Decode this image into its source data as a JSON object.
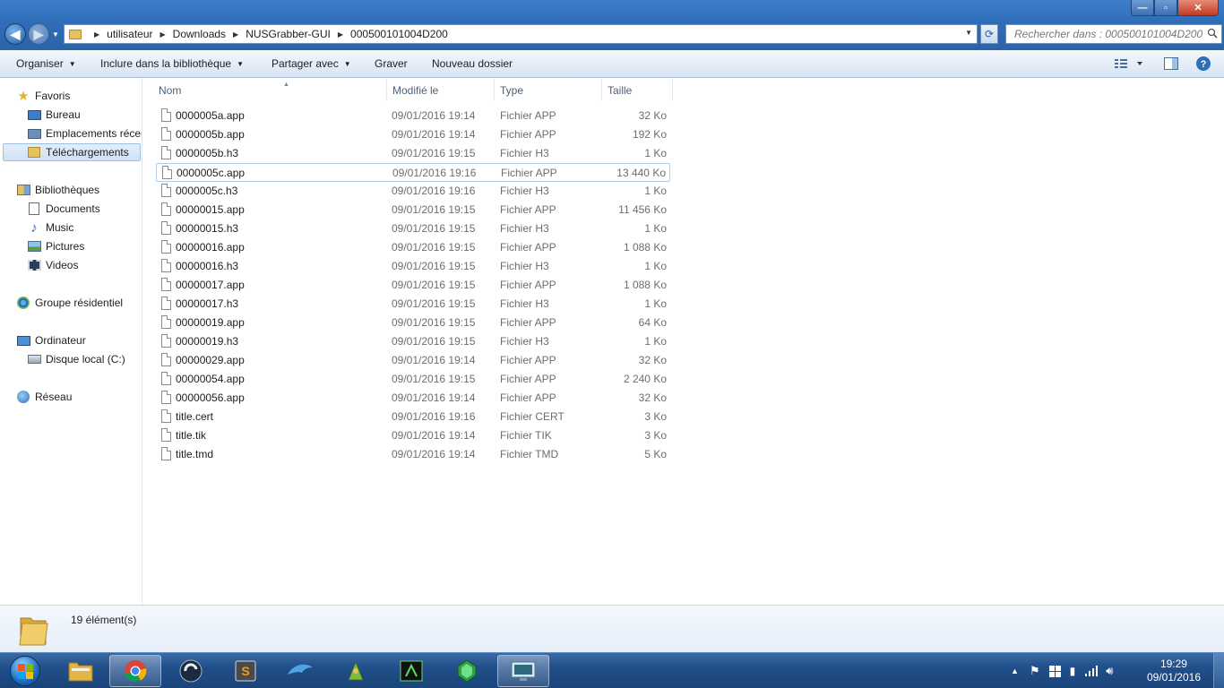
{
  "window": {
    "buttons": {
      "minimize": "—",
      "maximize": "▫",
      "close": "✕"
    }
  },
  "address": {
    "crumbs": [
      "utilisateur",
      "Downloads",
      "NUSGrabber-GUI",
      "000500101004D200"
    ],
    "search_placeholder": "Rechercher dans : 000500101004D200"
  },
  "toolbar": {
    "organize": "Organiser",
    "include": "Inclure dans la bibliothèque",
    "share": "Partager avec",
    "burn": "Graver",
    "new_folder": "Nouveau dossier"
  },
  "sidebar": {
    "favorites": "Favoris",
    "desktop": "Bureau",
    "recent": "Emplacements récents",
    "downloads": "Téléchargements",
    "libraries": "Bibliothèques",
    "documents": "Documents",
    "music": "Music",
    "pictures": "Pictures",
    "videos": "Videos",
    "homegroup": "Groupe résidentiel",
    "computer": "Ordinateur",
    "local_disk": "Disque local (C:)",
    "network": "Réseau"
  },
  "columns": {
    "name": "Nom",
    "modified": "Modifié le",
    "type": "Type",
    "size": "Taille"
  },
  "files": [
    {
      "name": "0000005a.app",
      "date": "09/01/2016 19:14",
      "type": "Fichier APP",
      "size": "32 Ko"
    },
    {
      "name": "0000005b.app",
      "date": "09/01/2016 19:14",
      "type": "Fichier APP",
      "size": "192 Ko"
    },
    {
      "name": "0000005b.h3",
      "date": "09/01/2016 19:15",
      "type": "Fichier H3",
      "size": "1 Ko"
    },
    {
      "name": "0000005c.app",
      "date": "09/01/2016 19:16",
      "type": "Fichier APP",
      "size": "13 440 Ko"
    },
    {
      "name": "0000005c.h3",
      "date": "09/01/2016 19:16",
      "type": "Fichier H3",
      "size": "1 Ko"
    },
    {
      "name": "00000015.app",
      "date": "09/01/2016 19:15",
      "type": "Fichier APP",
      "size": "11 456 Ko"
    },
    {
      "name": "00000015.h3",
      "date": "09/01/2016 19:15",
      "type": "Fichier H3",
      "size": "1 Ko"
    },
    {
      "name": "00000016.app",
      "date": "09/01/2016 19:15",
      "type": "Fichier APP",
      "size": "1 088 Ko"
    },
    {
      "name": "00000016.h3",
      "date": "09/01/2016 19:15",
      "type": "Fichier H3",
      "size": "1 Ko"
    },
    {
      "name": "00000017.app",
      "date": "09/01/2016 19:15",
      "type": "Fichier APP",
      "size": "1 088 Ko"
    },
    {
      "name": "00000017.h3",
      "date": "09/01/2016 19:15",
      "type": "Fichier H3",
      "size": "1 Ko"
    },
    {
      "name": "00000019.app",
      "date": "09/01/2016 19:15",
      "type": "Fichier APP",
      "size": "64 Ko"
    },
    {
      "name": "00000019.h3",
      "date": "09/01/2016 19:15",
      "type": "Fichier H3",
      "size": "1 Ko"
    },
    {
      "name": "00000029.app",
      "date": "09/01/2016 19:14",
      "type": "Fichier APP",
      "size": "32 Ko"
    },
    {
      "name": "00000054.app",
      "date": "09/01/2016 19:15",
      "type": "Fichier APP",
      "size": "2 240 Ko"
    },
    {
      "name": "00000056.app",
      "date": "09/01/2016 19:14",
      "type": "Fichier APP",
      "size": "32 Ko"
    },
    {
      "name": "title.cert",
      "date": "09/01/2016 19:16",
      "type": "Fichier CERT",
      "size": "3 Ko"
    },
    {
      "name": "title.tik",
      "date": "09/01/2016 19:14",
      "type": "Fichier TIK",
      "size": "3 Ko"
    },
    {
      "name": "title.tmd",
      "date": "09/01/2016 19:14",
      "type": "Fichier TMD",
      "size": "5 Ko"
    }
  ],
  "hovered_file": "0000005c.app",
  "status": {
    "count": "19 élément(s)"
  },
  "taskbar": {
    "apps": [
      "explorer-icon",
      "chrome-icon",
      "cinema4d-icon",
      "sublime-text-icon",
      "dolphin-icon",
      "app-icon",
      "terminal-app-icon",
      "emerald-icon",
      "screen-app-icon"
    ],
    "active_app": "screen-app-icon",
    "time": "19:29",
    "date": "09/01/2016"
  },
  "colors": {
    "accent": "#2e6db7",
    "taskbar": "#214f8a",
    "selection": "#cfe1f6"
  }
}
